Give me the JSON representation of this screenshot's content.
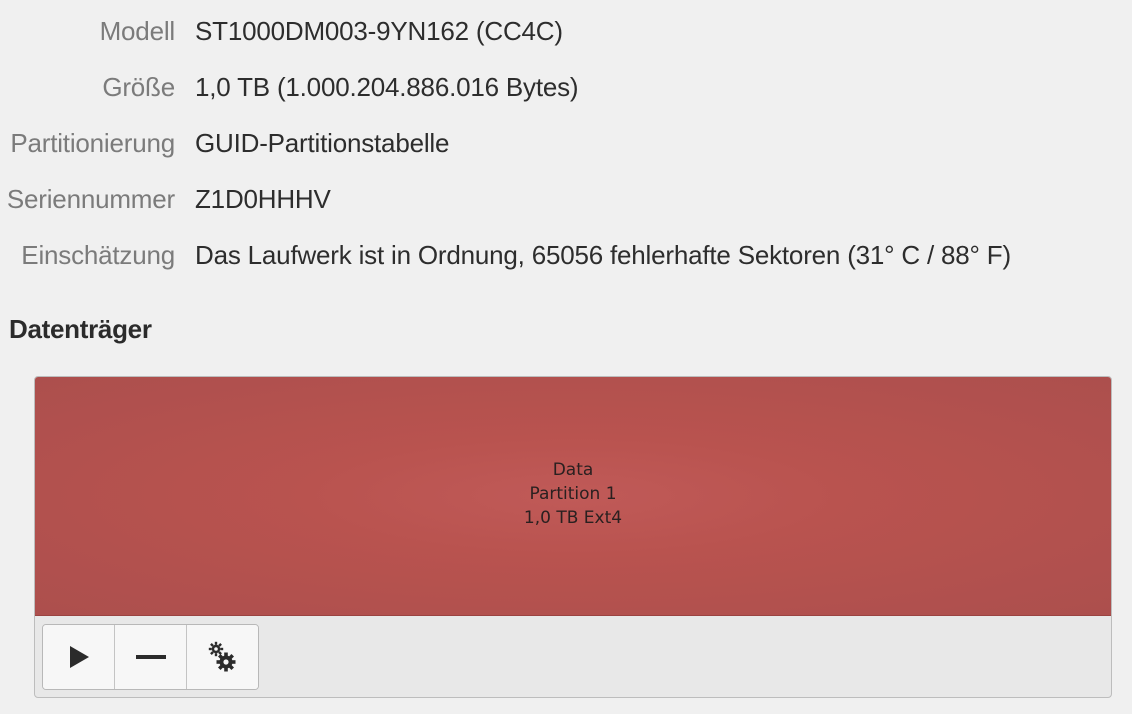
{
  "details": [
    {
      "label": "Modell",
      "value": "ST1000DM003-9YN162 (CC4C)"
    },
    {
      "label": "Größe",
      "value": "1,0 TB (1.000.204.886.016 Bytes)"
    },
    {
      "label": "Partitionierung",
      "value": "GUID-Partitionstabelle"
    },
    {
      "label": "Seriennummer",
      "value": "Z1D0HHHV"
    },
    {
      "label": "Einschätzung",
      "value": "Das Laufwerk ist in Ordnung, 65056 fehlerhafte Sektoren (31° C / 88° F)"
    }
  ],
  "volumes_section": {
    "title": "Datenträger"
  },
  "partition": {
    "name": "Data",
    "number_label": "Partition 1",
    "size_fs": "1,0 TB Ext4",
    "color": "#b9534f"
  },
  "toolbar": {
    "buttons": [
      {
        "icon": "play-icon"
      },
      {
        "icon": "minus-icon"
      },
      {
        "icon": "gears-icon"
      }
    ]
  }
}
